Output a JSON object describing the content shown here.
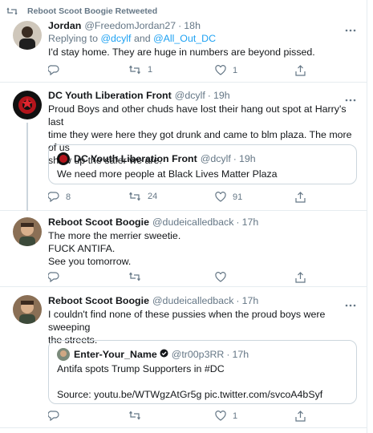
{
  "retweet_banner": "Reboot Scoot Boogie Retweeted",
  "tweets": [
    {
      "name": "Jordan",
      "handle": "@FreedomJordan27",
      "time": "18h",
      "replying_prefix": "Replying to ",
      "replying_a": "@dcylf",
      "replying_and": " and ",
      "replying_b": "@All_Out_DC",
      "text": "I'd stay home. They are huge in numbers are beyond pissed.",
      "retweets": "1",
      "likes": "1"
    },
    {
      "name": "DC Youth Liberation Front",
      "handle": "@dcylf",
      "time": "19h",
      "text_lines": [
        "Proud Boys and other chuds have lost their hang out spot at Harry's last",
        "time they were here they got drunk and came to blm plaza. The more of us",
        "show up the safer we are."
      ],
      "quote": {
        "name": "DC Youth Liberation Front",
        "handle": "@dcylf",
        "time": "19h",
        "text": "We need more people at Black Lives Matter Plaza"
      },
      "replies": "8",
      "retweets": "24",
      "likes": "91"
    },
    {
      "name": "Reboot Scoot Boogie",
      "handle": "@dudeicalledback",
      "time": "17h",
      "text_lines": [
        "The more the merrier sweetie.",
        "FUCK ANTIFA.",
        "See you tomorrow."
      ]
    },
    {
      "name": "Reboot Scoot Boogie",
      "handle": "@dudeicalledback",
      "time": "17h",
      "text_lines": [
        "I couldn't find none of these pussies when the proud boys were sweeping",
        "the streets."
      ],
      "quote": {
        "name": "Enter-Your_Name",
        "handle": "@tr00p3RR",
        "time": "17h",
        "text_lines": [
          "Antifa spots Trump Supporters in #DC",
          "",
          "Source: youtu.be/WTWgzAtGr5g pic.twitter.com/svcoA4bSyf"
        ]
      },
      "likes": "1"
    }
  ],
  "colors": {
    "accent": "#1da1f2",
    "muted": "#657786",
    "border": "#e6ecf0",
    "quote_border": "#ccd6dd"
  },
  "icons": [
    "retweet-icon",
    "reply-icon",
    "like-icon",
    "share-icon",
    "more-icon",
    "verified-badge-icon"
  ]
}
